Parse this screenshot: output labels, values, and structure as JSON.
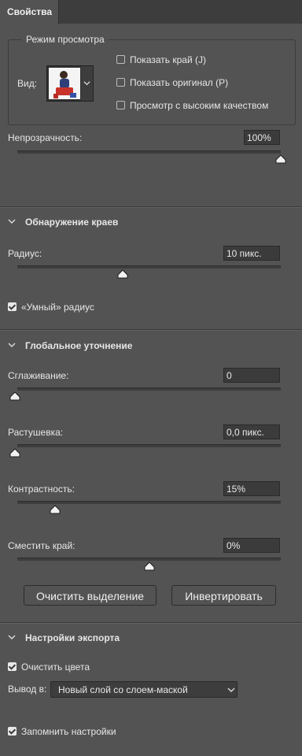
{
  "tab": {
    "label": "Свойства"
  },
  "view_mode": {
    "title": "Режим просмотра",
    "view_label": "Вид:",
    "options": [
      {
        "label": "Показать край (J)",
        "checked": false
      },
      {
        "label": "Показать оригинал (P)",
        "checked": false
      },
      {
        "label": "Просмотр с высоким качеством",
        "checked": false
      }
    ]
  },
  "opacity": {
    "label": "Непрозрачность:",
    "value": "100%",
    "fraction": 1.0
  },
  "edge_detection": {
    "title": "Обнаружение краев",
    "radius": {
      "label": "Радиус:",
      "value": "10 пикс.",
      "fraction": 0.4
    },
    "smart_radius": {
      "label": "«Умный» радиус",
      "checked": true
    }
  },
  "global_refinement": {
    "title": "Глобальное уточнение",
    "smooth": {
      "label": "Сглаживание:",
      "value": "0",
      "fraction": 0.0
    },
    "feather": {
      "label": "Растушевка:",
      "value": "0,0 пикс.",
      "fraction": 0.0
    },
    "contrast": {
      "label": "Контрастность:",
      "value": "15%",
      "fraction": 0.15
    },
    "shift_edge": {
      "label": "Сместить край:",
      "value": "0%",
      "fraction": 0.5
    },
    "clear_selection_button": "Очистить выделение",
    "invert_button": "Инвертировать"
  },
  "export": {
    "title": "Настройки экспорта",
    "decontaminate": {
      "label": "Очистить цвета",
      "checked": true
    },
    "output_label": "Вывод в:",
    "output_value": "Новый слой со слоем-маской"
  },
  "remember": {
    "label": "Запомнить настройки",
    "checked": true
  },
  "colors": {
    "panel": "#535353",
    "field": "#3b3b3b",
    "text": "#e6e6e6"
  }
}
